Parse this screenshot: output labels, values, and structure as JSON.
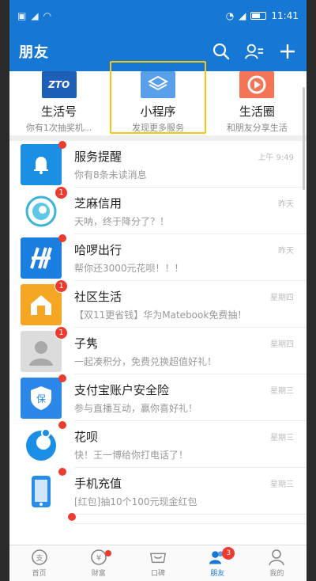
{
  "status_bar": {
    "time": "11:41"
  },
  "header": {
    "title": "朋友"
  },
  "services": [
    {
      "icon": "zto-logo-icon",
      "logo_text": "ZTO",
      "name": "生活号",
      "desc": "你有1次抽奖机..."
    },
    {
      "icon": "mini-program-icon",
      "name": "小程序",
      "desc": "发现更多服务"
    },
    {
      "icon": "life-circle-icon",
      "name": "生活圈",
      "desc": "和朋友分享生活"
    }
  ],
  "messages": [
    {
      "title": "服务提醒",
      "sub": "你有8条未读消息",
      "time": "上午 9:49",
      "badge": "dot"
    },
    {
      "title": "芝麻信用",
      "sub": "天呐，终于降分了？！",
      "time": "昨天",
      "badge": "1"
    },
    {
      "title": "哈啰出行",
      "sub": "帮你还3000元花呗！！！",
      "time": "昨天",
      "badge": "dot"
    },
    {
      "title": "社区生活",
      "sub": "【双11更省钱】华为Matebook免费抽！",
      "time": "星期四",
      "badge": "1"
    },
    {
      "title": "子隽",
      "sub": "一起凑积分，免费兑换超值好礼！",
      "time": "星期四",
      "badge": "1"
    },
    {
      "title": "支付宝账户安全险",
      "sub": "参与直播互动，赢你喜好礼！",
      "time": "星期三",
      "badge": "dot"
    },
    {
      "title": "花呗",
      "sub": "快！王一博给你打电话了！",
      "time": "星期三",
      "badge": "dot"
    },
    {
      "title": "手机充值",
      "sub": "[红包]抽10个100元现金红包",
      "time": "星期三",
      "badge": "dot"
    }
  ],
  "tabs": [
    {
      "label": "首页",
      "icon": "home-icon"
    },
    {
      "label": "财富",
      "icon": "wealth-icon",
      "badge": "dot"
    },
    {
      "label": "口碑",
      "icon": "koubei-icon"
    },
    {
      "label": "朋友",
      "icon": "friends-icon",
      "badge": "3",
      "active": true
    },
    {
      "label": "我的",
      "icon": "profile-icon"
    }
  ],
  "colors": {
    "brand_blue": "#1677d4",
    "badge_red": "#ee3b30",
    "focus_yellow": "#f5c518"
  }
}
